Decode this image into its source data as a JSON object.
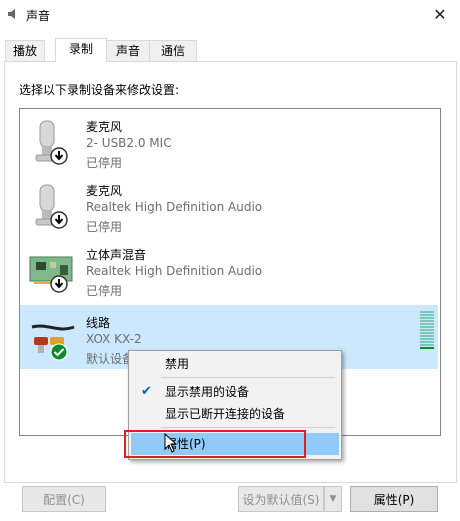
{
  "window": {
    "title": "声音",
    "close_glyph": "✕"
  },
  "tabs": [
    {
      "label": "播放",
      "active": false
    },
    {
      "label": "录制",
      "active": true
    },
    {
      "label": "声音",
      "active": false
    },
    {
      "label": "通信",
      "active": false
    }
  ],
  "instruction": "选择以下录制设备来修改设置:",
  "devices": [
    {
      "name": "麦克风",
      "description": "2- USB2.0 MIC",
      "status": "已停用",
      "icon": "microphone-icon",
      "badge": "disabled-arrow-icon"
    },
    {
      "name": "麦克风",
      "description": "Realtek High Definition Audio",
      "status": "已停用",
      "icon": "microphone-icon",
      "badge": "disabled-arrow-icon"
    },
    {
      "name": "立体声混音",
      "description": "Realtek High Definition Audio",
      "status": "已停用",
      "icon": "sound-card-icon",
      "badge": "disabled-arrow-icon"
    },
    {
      "name": "线路",
      "description": "XOX KX-2",
      "status": "默认设备",
      "icon": "line-in-cable-icon",
      "badge": "default-check-icon",
      "selected": true
    }
  ],
  "context_menu": {
    "items": [
      {
        "label": "禁用",
        "checked": false
      },
      {
        "label": "显示禁用的设备",
        "checked": true
      },
      {
        "label": "显示已断开连接的设备",
        "checked": false
      },
      {
        "label": "属性(P)",
        "checked": false,
        "hovered": true
      }
    ],
    "check_glyph": "✔"
  },
  "buttons": {
    "configure": "配置(C)",
    "set_default": "设为默认值(S)",
    "properties": "属性(P)",
    "dropdown_glyph": "▼"
  },
  "colors": {
    "selection": "#cce8ff",
    "menu_hover": "#91c9f7",
    "highlight": "#e02020",
    "default_check": "#0a8a2c"
  }
}
